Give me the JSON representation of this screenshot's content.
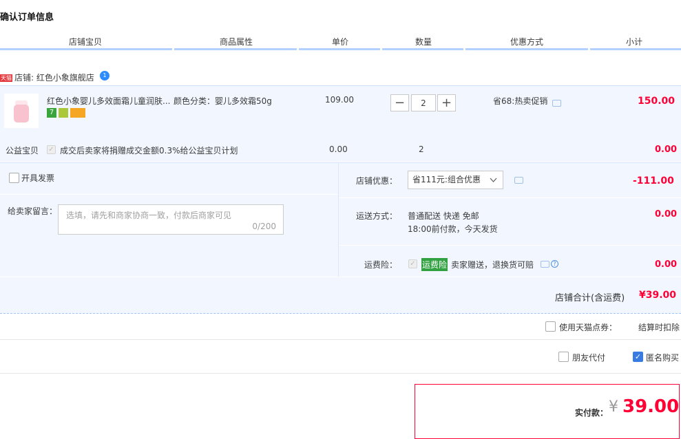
{
  "page_title": "确认订单信息",
  "columns": [
    "店铺宝贝",
    "商品属性",
    "单价",
    "数量",
    "优惠方式",
    "小计"
  ],
  "shop": {
    "label": "店铺:",
    "name": "红色小象旗舰店",
    "badge": "天猫",
    "wangwang_count": "1"
  },
  "item": {
    "title": "红色小象婴儿多效面霜儿童润肤...",
    "attribute": "颜色分类：婴儿多效霜50g",
    "unit_price": "109.00",
    "quantity": "2",
    "promotion": "省68:热卖促销",
    "subtotal": "150.00",
    "minus": "−",
    "plus": "+",
    "icon_seven": "7"
  },
  "charity": {
    "label": "公益宝贝",
    "text": "成交后卖家将捐赠成交金额0.3%给公益宝贝计划",
    "price": "0.00",
    "quantity": "2",
    "subtotal": "0.00"
  },
  "invoice": {
    "label": "开具发票"
  },
  "message": {
    "label": "给卖家留言：",
    "placeholder": "选填，请先和商家协商一致，付款后商家可见",
    "counter": "0/200"
  },
  "shop_discount": {
    "label": "店铺优惠：",
    "selected": "省111元:组合优惠",
    "amount": "-111.00"
  },
  "shipping": {
    "label": "运送方式：",
    "line1": "普通配送 快递 免邮",
    "line2": "18:00前付款，今天发货",
    "amount": "0.00"
  },
  "insurance": {
    "label": "运费险：",
    "tag": "运费险",
    "text": "卖家赠送，退换货可赔",
    "amount": "0.00"
  },
  "shop_total": {
    "label": "店铺合计(含运费)",
    "amount": "¥39.00"
  },
  "points": {
    "label": "使用天猫点券：",
    "value": "结算时扣除"
  },
  "friend_pay": {
    "label": "朋友代付"
  },
  "anonymous": {
    "label": "匿名购买",
    "checked": true
  },
  "payment": {
    "label": "实付款：",
    "currency": "¥",
    "amount": "39.00"
  },
  "colors": {
    "accent_red": "#ff0036",
    "header_line": "#b2d1ff",
    "panel_bg": "#f2f7ff"
  }
}
